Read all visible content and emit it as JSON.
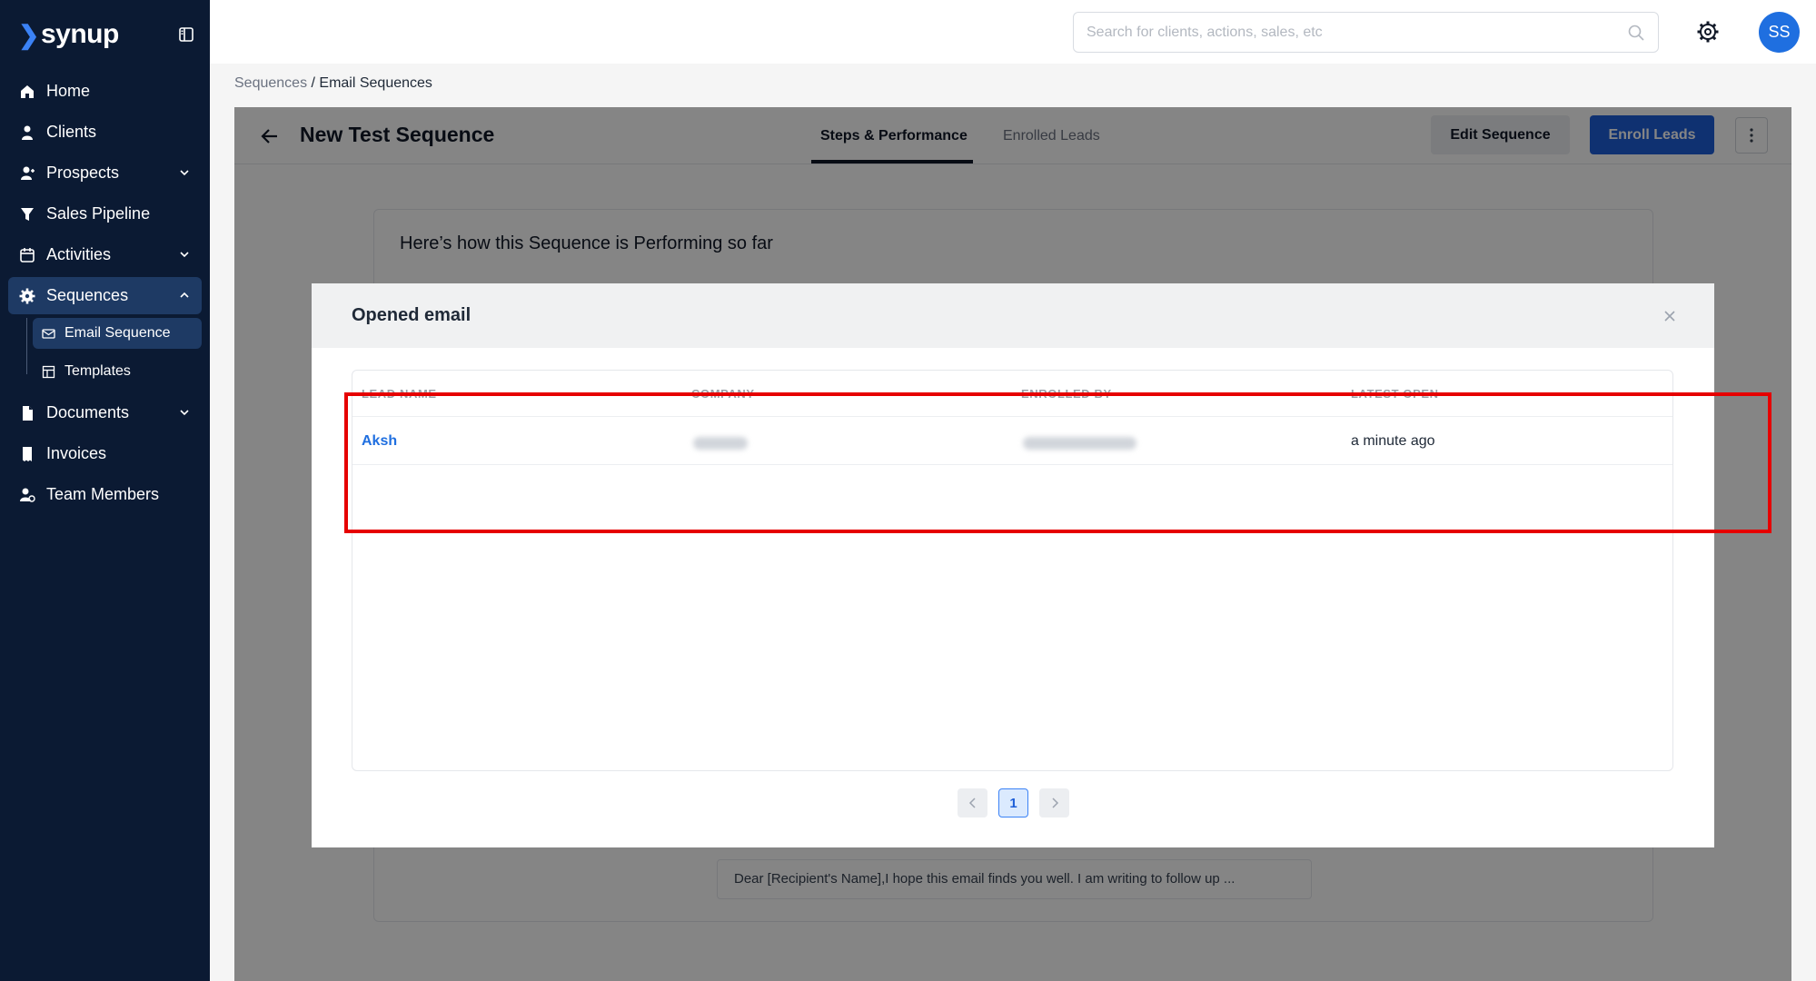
{
  "app": {
    "brand": "synup"
  },
  "sidebar": {
    "items": [
      {
        "label": "Home",
        "icon": "home-icon"
      },
      {
        "label": "Clients",
        "icon": "person-icon"
      },
      {
        "label": "Prospects",
        "icon": "prospect-icon"
      },
      {
        "label": "Sales Pipeline",
        "icon": "funnel-icon"
      },
      {
        "label": "Activities",
        "icon": "calendar-icon"
      },
      {
        "label": "Sequences",
        "icon": "gear-icon"
      },
      {
        "label": "Documents",
        "icon": "document-icon"
      },
      {
        "label": "Invoices",
        "icon": "invoice-icon"
      },
      {
        "label": "Team Members",
        "icon": "team-icon"
      }
    ],
    "sub_items": [
      {
        "label": "Email Sequence",
        "icon": "mail-icon"
      },
      {
        "label": "Templates",
        "icon": "template-icon"
      }
    ]
  },
  "search": {
    "placeholder": "Search for clients, actions, sales, etc"
  },
  "user": {
    "initials": "SS"
  },
  "breadcrumb": {
    "parent": "Sequences",
    "separator": " / ",
    "current": "Email Sequences"
  },
  "sequence": {
    "title": "New Test Sequence",
    "tabs": [
      "Steps & Performance",
      "Enrolled Leads"
    ],
    "edit_label": "Edit Sequence",
    "enroll_label": "Enroll Leads",
    "performance_title": "Here’s how this Sequence is Performing so far",
    "email_preview": "Dear [Recipient's Name],I hope this email finds you well. I am writing to follow up ..."
  },
  "modal": {
    "title": "Opened email",
    "columns": [
      "LEAD NAME",
      "COMPANY",
      "ENROLLED BY",
      "LATEST OPEN"
    ],
    "rows": [
      {
        "lead_name": "Aksh",
        "latest_open": "a minute ago"
      }
    ],
    "pagination": {
      "current_page": "1"
    }
  },
  "colors": {
    "sidebar_bg": "#0b1a33",
    "primary": "#1e5fd8",
    "highlight": "#e60000",
    "link": "#1f6fe0"
  }
}
